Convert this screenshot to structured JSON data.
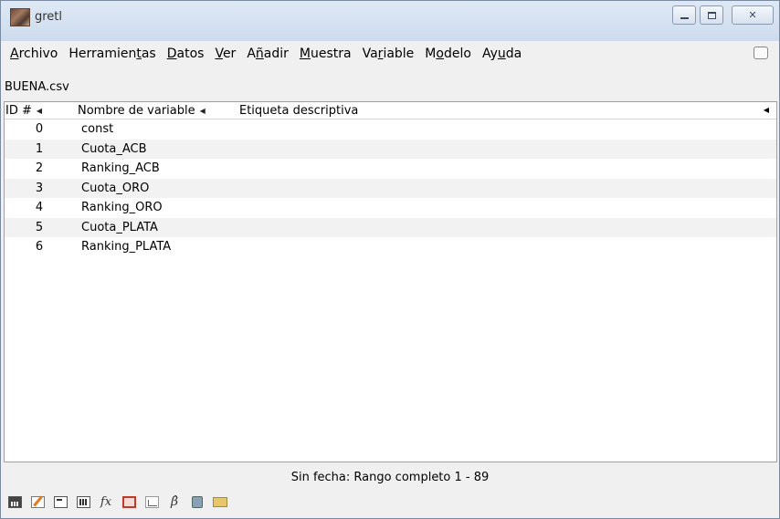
{
  "window": {
    "title": "gretl",
    "icon": "gretl-app-icon",
    "controls": {
      "minimize": "minimize-icon",
      "maximize": "maximize-icon",
      "close": "close-icon"
    }
  },
  "menubar": {
    "items": [
      {
        "label": "Archivo",
        "mnemonic": "A"
      },
      {
        "label": "Herramientas",
        "mnemonic": "t"
      },
      {
        "label": "Datos",
        "mnemonic": "D"
      },
      {
        "label": "Ver",
        "mnemonic": "V"
      },
      {
        "label": "Añadir",
        "mnemonic": "ñ"
      },
      {
        "label": "Muestra",
        "mnemonic": "M"
      },
      {
        "label": "Variable",
        "mnemonic": "r"
      },
      {
        "label": "Modelo",
        "mnemonic": "o"
      },
      {
        "label": "Ayuda",
        "mnemonic": "u"
      }
    ]
  },
  "dataset": {
    "filename": "BUENA.csv"
  },
  "table": {
    "headers": {
      "id": "ID #",
      "name": "Nombre de variable",
      "label": "Etiqueta descriptiva"
    },
    "rows": [
      {
        "id": "0",
        "name": "const",
        "label": ""
      },
      {
        "id": "1",
        "name": "Cuota_ACB",
        "label": ""
      },
      {
        "id": "2",
        "name": "Ranking_ACB",
        "label": ""
      },
      {
        "id": "3",
        "name": "Cuota_ORO",
        "label": ""
      },
      {
        "id": "4",
        "name": "Ranking_ORO",
        "label": ""
      },
      {
        "id": "5",
        "name": "Cuota_PLATA",
        "label": ""
      },
      {
        "id": "6",
        "name": "Ranking_PLATA",
        "label": ""
      }
    ]
  },
  "status": {
    "text": "Sin fecha: Rango completo 1 - 89"
  },
  "toolbar": {
    "icons": [
      "calculator-icon",
      "edit-script-icon",
      "terminal-icon",
      "session-icons-icon",
      "function-fx-icon",
      "network-icon",
      "plot-icon",
      "beta-model-icon",
      "database-icon",
      "folder-icon"
    ],
    "fx_label": "fx",
    "beta_label": "β̂"
  }
}
